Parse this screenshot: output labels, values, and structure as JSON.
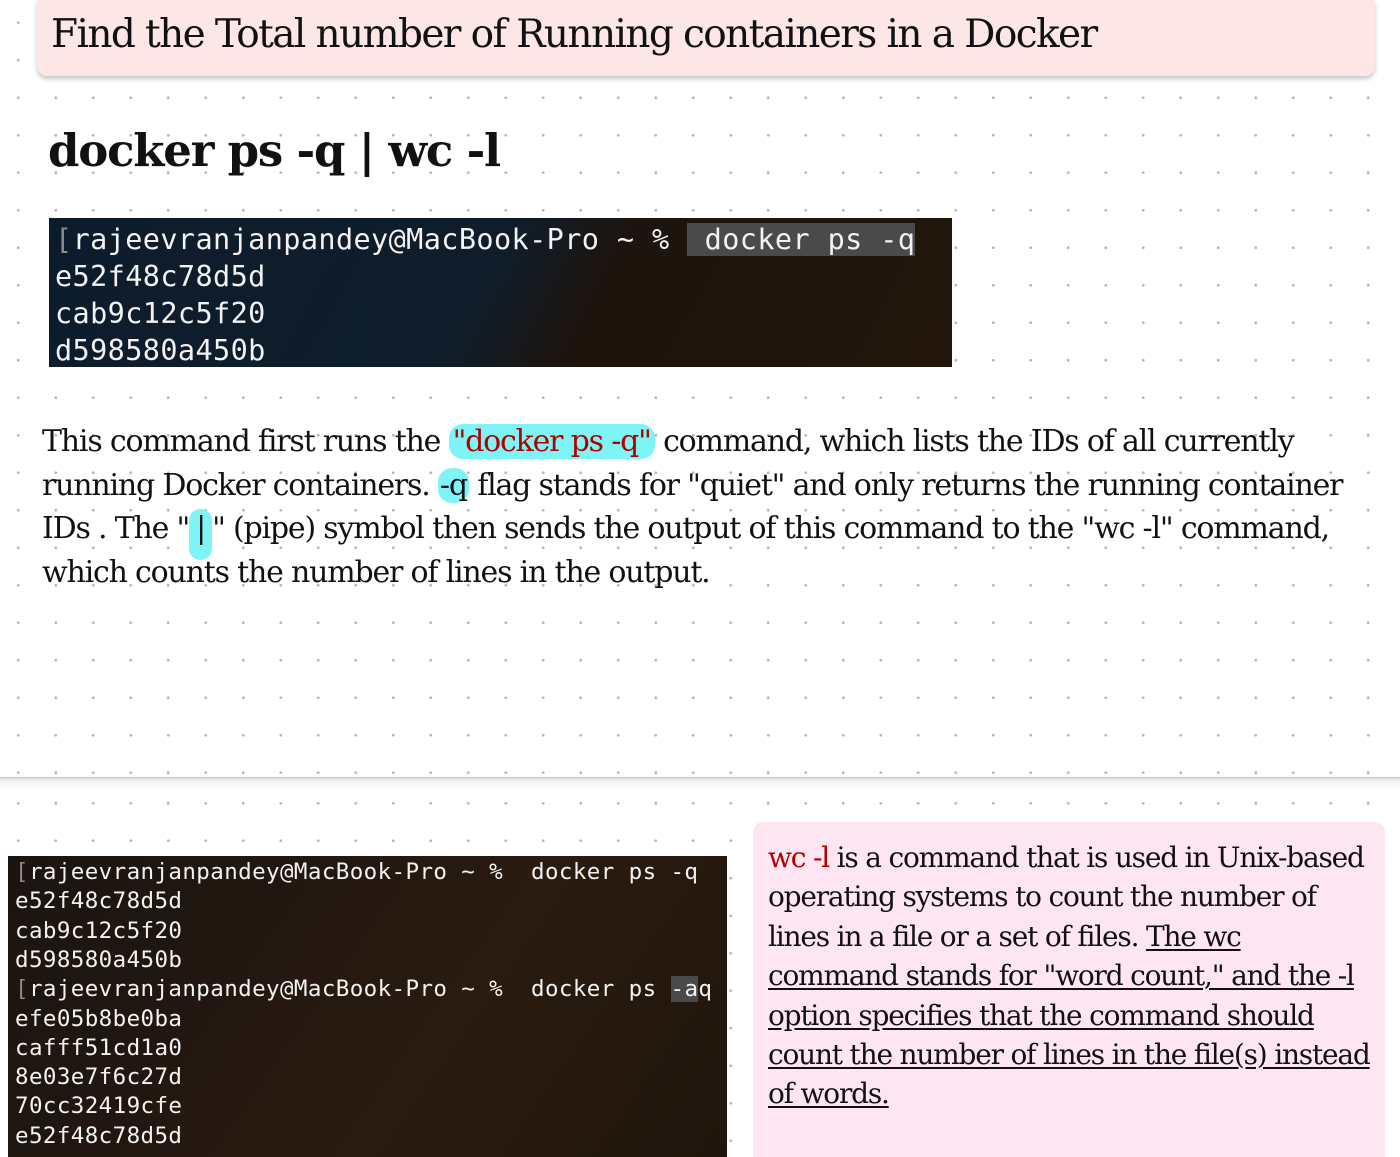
{
  "title": "Find the Total number of Running containers in a Docker",
  "headline_command": "docker ps -q | wc -l",
  "terminal_1": {
    "prompt": "rajeevranjanpandey@MacBook-Pro ~ % ",
    "command": " docker ps -q",
    "output": [
      "e52f48c78d5d",
      "cab9c12c5f20",
      "d598580a450b"
    ]
  },
  "explanation": {
    "part1": "This command first runs the ",
    "hl_command": "\"docker ps -q\"",
    "part2": " command, which lists the IDs of all currently running Docker containers. ",
    "hl_flag": "-q",
    "part3": " flag stands for \"quiet\" and only returns the running container IDs . The \"",
    "hl_pipe": "|",
    "part4": "\" (pipe) symbol then sends the output of this command to the \"wc -l\" command, which counts the number of lines in the output."
  },
  "terminal_2": {
    "session_1": {
      "prompt": "rajeevranjanpandey@MacBook-Pro ~ % ",
      "command": " docker ps -q",
      "output": [
        "e52f48c78d5d",
        "cab9c12c5f20",
        "d598580a450b"
      ]
    },
    "session_2": {
      "prompt": "rajeevranjanpandey@MacBook-Pro ~ % ",
      "command_pre": " docker ps ",
      "command_flag": "-a",
      "command_post": "q",
      "output": [
        "efe05b8be0ba",
        "cafff51cd1a0",
        "8e03e7f6c27d",
        "70cc32419cfe",
        "e52f48c78d5d"
      ]
    }
  },
  "wc_note": {
    "term": "wc -l",
    "plain": " is a command that is used in Unix-based operating systems to count the number of lines in a file or a set of files. ",
    "underlined": "The wc command stands for \"word count,\" and the -l option specifies that the command should count the number of lines in the file(s) instead of words."
  },
  "colors": {
    "title_banner": "#fde6e6",
    "note_background": "#fde6f2",
    "highlight_cyan": "#7ff4f6",
    "highlight_red": "#b00000"
  }
}
